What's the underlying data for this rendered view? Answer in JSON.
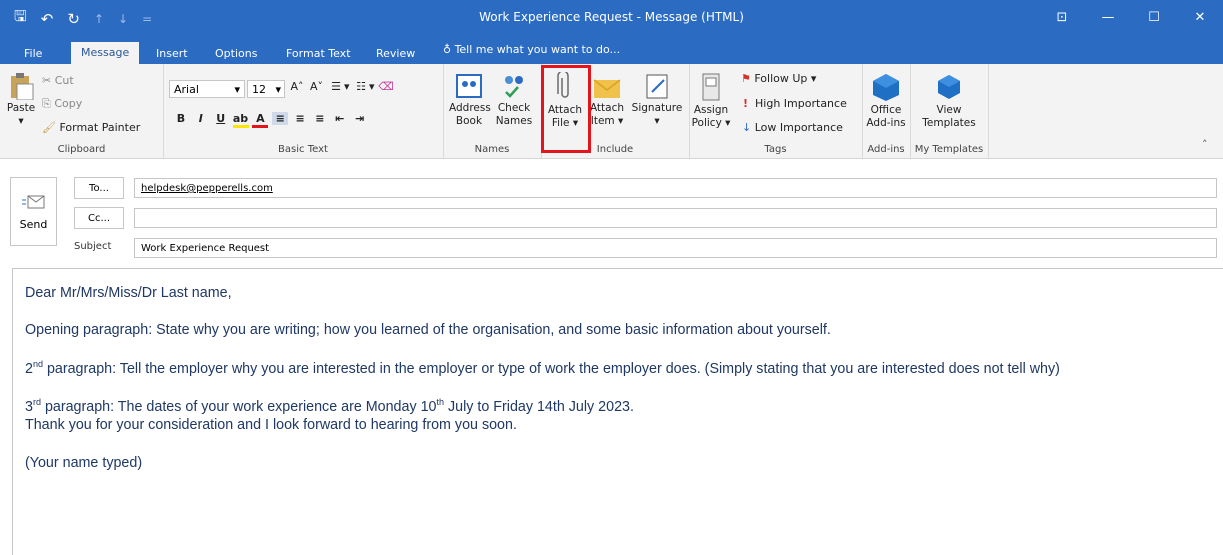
{
  "window": {
    "title": "Work Experience Request - Message (HTML)",
    "controls": [
      "⊡",
      "—",
      "☐",
      "✕"
    ]
  },
  "tabs": [
    "File",
    "Message",
    "Insert",
    "Options",
    "Format Text",
    "Review"
  ],
  "active_tab": "Message",
  "tell_me": "Tell me what you want to do...",
  "ribbon": {
    "clipboard": {
      "group": "Clipboard",
      "paste": "Paste",
      "cut": "Cut",
      "copy": "Copy",
      "format_painter": "Format Painter"
    },
    "basic_text": {
      "group": "Basic Text",
      "font": "Arial",
      "size": "12"
    },
    "names": {
      "group": "Names",
      "address_book_1": "Address",
      "address_book_2": "Book",
      "check_names_1": "Check",
      "check_names_2": "Names"
    },
    "include": {
      "group": "Include",
      "attach_file_1": "Attach",
      "attach_file_2": "File ▾",
      "attach_item_1": "Attach",
      "attach_item_2": "Item ▾",
      "signature_1": "Signature",
      "signature_2": "▾"
    },
    "tags": {
      "group": "Tags",
      "assign_policy_1": "Assign",
      "assign_policy_2": "Policy ▾",
      "follow_up": "Follow Up ▾",
      "high_importance": "High Importance",
      "low_importance": "Low Importance"
    },
    "addins": {
      "group": "Add-ins",
      "office_1": "Office",
      "office_2": "Add-ins"
    },
    "templates": {
      "group": "My Templates",
      "view_1": "View",
      "view_2": "Templates"
    }
  },
  "compose": {
    "send": "Send",
    "to_button": "To...",
    "cc_button": "Cc...",
    "to_value": "helpdesk@pepperells.com",
    "cc_value": "",
    "subject_label": "Subject",
    "subject_value": "Work Experience Request"
  },
  "body": {
    "greeting": "Dear Mr/Mrs/Miss/Dr   Last name,",
    "p1": "Opening paragraph: State why you are writing; how you learned of the organisation, and some basic information about yourself.",
    "p2_num": "2",
    "p2_sup": "nd",
    "p2": " paragraph: Tell the employer why you are interested in the employer or type of work the employer does. (Simply stating that you are interested does not tell why)",
    "p3_num": "3",
    "p3_sup": "rd",
    "p3a": " paragraph:  The dates of your work experience are Monday 10",
    "p3_sup2": "th",
    "p3b": " July to Friday 14th July 2023.",
    "p4": "Thank you for your consideration and I look forward to hearing from you soon.",
    "p5": "(Your name typed)"
  },
  "colors": {
    "titlebar": "#2b6bc2",
    "ribbon": "#f3f3f3",
    "highlight": "#e3141b",
    "body_text": "#1f3864"
  }
}
